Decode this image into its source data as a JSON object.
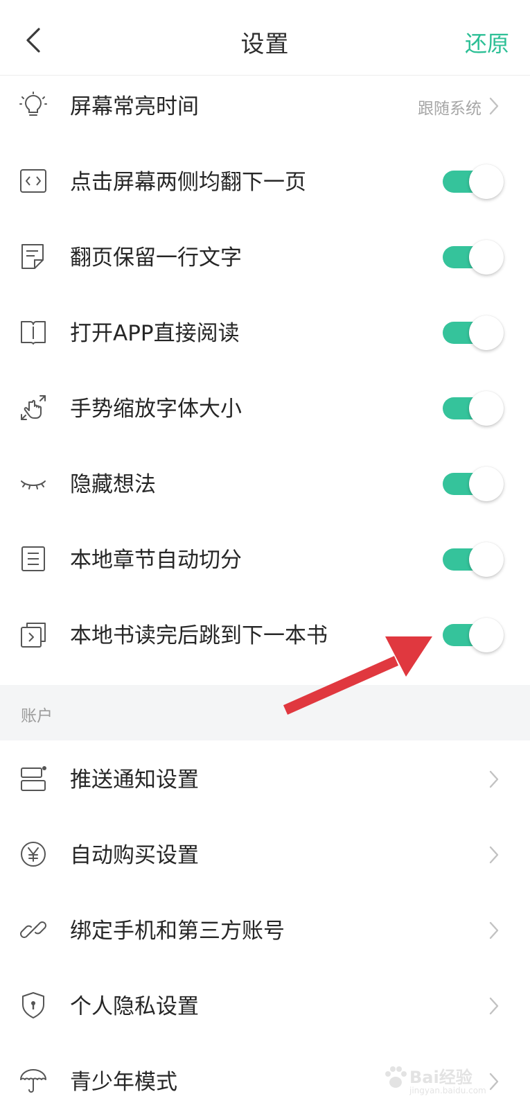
{
  "header": {
    "title": "设置",
    "back_icon": "chevron-left-icon",
    "restore_label": "还原",
    "accent_color": "#2bbf95"
  },
  "reading": [
    {
      "label": "屏幕常亮时间",
      "icon": "lightbulb-icon",
      "control": "value",
      "value": "跟随系统"
    },
    {
      "label": "点击屏幕两侧均翻下一页",
      "icon": "code-brackets-icon",
      "control": "toggle",
      "on": true
    },
    {
      "label": "翻页保留一行文字",
      "icon": "note-icon",
      "control": "toggle",
      "on": true
    },
    {
      "label": "打开APP直接阅读",
      "icon": "book-icon",
      "control": "toggle",
      "on": true
    },
    {
      "label": "手势缩放字体大小",
      "icon": "gesture-icon",
      "control": "toggle",
      "on": true
    },
    {
      "label": "隐藏想法",
      "icon": "eye-closed-icon",
      "control": "toggle",
      "on": true
    },
    {
      "label": "本地章节自动切分",
      "icon": "list-doc-icon",
      "control": "toggle",
      "on": true
    },
    {
      "label": "本地书读完后跳到下一本书",
      "icon": "next-book-icon",
      "control": "toggle",
      "on": true
    }
  ],
  "account_section": {
    "title": "账户",
    "items": [
      {
        "label": "推送通知设置",
        "icon": "notification-icon"
      },
      {
        "label": "自动购买设置",
        "icon": "yen-icon"
      },
      {
        "label": "绑定手机和第三方账号",
        "icon": "link-icon"
      },
      {
        "label": "个人隐私设置",
        "icon": "shield-icon"
      },
      {
        "label": "青少年模式",
        "icon": "umbrella-icon"
      }
    ]
  },
  "watermark": {
    "text": "Bai经验",
    "url": "jingyan.baidu.com"
  },
  "colors": {
    "toggle_on": "#35c39b",
    "annotation_arrow": "#e0383f",
    "section_bg": "#f4f5f6"
  }
}
